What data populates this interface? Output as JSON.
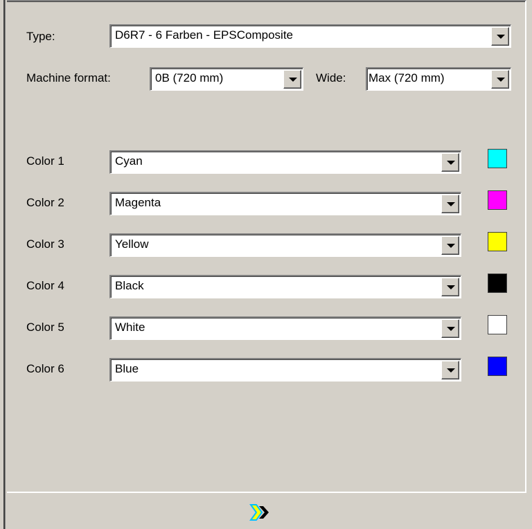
{
  "settings": {
    "type_label": "Type:",
    "type_value": "D6R7 - 6 Farben - EPSComposite",
    "machine_format_label": "Machine format:",
    "machine_format_value": "0B (720 mm)",
    "wide_label": "Wide:",
    "wide_value": "Max (720 mm)"
  },
  "colors": [
    {
      "label": "Color 1",
      "value": "Cyan",
      "swatch": "#00ffff"
    },
    {
      "label": "Color 2",
      "value": "Magenta",
      "swatch": "#ff00ff"
    },
    {
      "label": "Color 3",
      "value": "Yellow",
      "swatch": "#ffff00"
    },
    {
      "label": "Color 4",
      "value": "Black",
      "swatch": "#000000"
    },
    {
      "label": "Color 5",
      "value": "White",
      "swatch": "#ffffff"
    },
    {
      "label": "Color 6",
      "value": "Blue",
      "swatch": "#0000ff"
    }
  ],
  "footer": {
    "icon": "arrow-logo-icon"
  }
}
